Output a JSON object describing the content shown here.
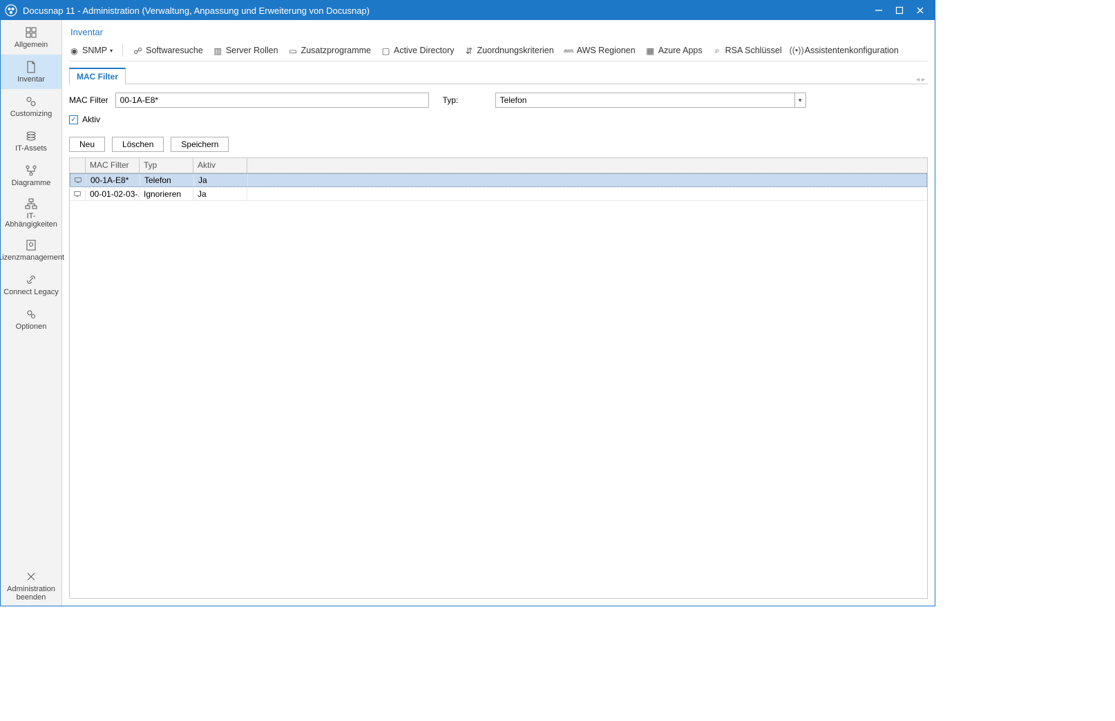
{
  "window": {
    "title": "Docusnap 11 - Administration (Verwaltung, Anpassung und Erweiterung von Docusnap)"
  },
  "sidebar": {
    "items": [
      {
        "label": "Allgemein",
        "icon": "grid"
      },
      {
        "label": "Inventar",
        "icon": "doc"
      },
      {
        "label": "Customizing",
        "icon": "gears"
      },
      {
        "label": "IT-Assets",
        "icon": "stack"
      },
      {
        "label": "Diagramme",
        "icon": "diagram"
      },
      {
        "label": "IT-Abhängigkeiten",
        "icon": "depend"
      },
      {
        "label": "Lizenzmanagement",
        "icon": "license"
      },
      {
        "label": "Connect Legacy",
        "icon": "link"
      },
      {
        "label": "Optionen",
        "icon": "gears2"
      }
    ],
    "exit": {
      "label": "Administration\nbeenden",
      "icon": "close"
    }
  },
  "breadcrumb": "Inventar",
  "toolbar": {
    "items": [
      {
        "label": "SNMP",
        "dropdown": true,
        "icon": "snmp"
      },
      {
        "label": "Softwaresuche",
        "icon": "link2"
      },
      {
        "label": "Server Rollen",
        "icon": "server"
      },
      {
        "label": "Zusatzprogramme",
        "icon": "briefcase"
      },
      {
        "label": "Active Directory",
        "icon": "ad"
      },
      {
        "label": "Zuordnungskriterien",
        "icon": "assign"
      },
      {
        "label": "AWS Regionen",
        "icon": "aws"
      },
      {
        "label": "Azure Apps",
        "icon": "azure"
      },
      {
        "label": "RSA Schlüssel",
        "icon": "key"
      },
      {
        "label": "Assistentenkonfiguration",
        "icon": "wizard"
      }
    ]
  },
  "tab": {
    "label": "MAC Filter"
  },
  "form": {
    "mac_label": "MAC Filter",
    "mac_value": "00-1A-E8*",
    "typ_label": "Typ:",
    "typ_value": "Telefon",
    "aktiv_label": "Aktiv",
    "aktiv_checked": true
  },
  "buttons": {
    "neu": "Neu",
    "loeschen": "Löschen",
    "speichern": "Speichern"
  },
  "grid": {
    "headers": {
      "mac": "MAC Filter",
      "typ": "Typ",
      "aktiv": "Aktiv"
    },
    "rows": [
      {
        "mac": "00-1A-E8*",
        "typ": "Telefon",
        "aktiv": "Ja",
        "selected": true
      },
      {
        "mac": "00-01-02-03-...",
        "typ": "Ignorieren",
        "aktiv": "Ja",
        "selected": false
      }
    ]
  }
}
